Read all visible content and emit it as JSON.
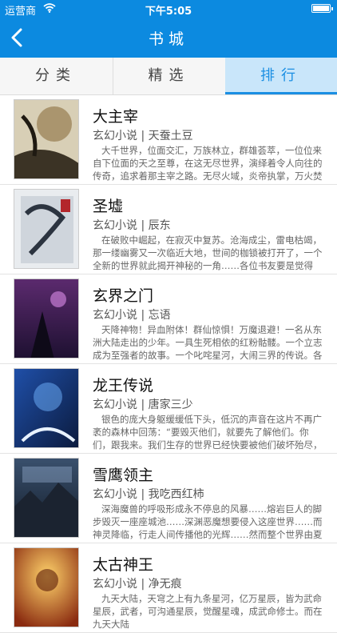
{
  "status_bar": {
    "carrier": "运营商",
    "time": "下午5:05"
  },
  "nav": {
    "title": "书城",
    "back_icon": "chevron-left-icon"
  },
  "tabs": [
    {
      "label": "分类",
      "selected": false
    },
    {
      "label": "精选",
      "selected": false
    },
    {
      "label": "排行",
      "selected": true
    }
  ],
  "colors": {
    "accent": "#0c8ae0",
    "tab_active_bg": "#c9e6fa",
    "tab_active_text": "#1b8fe3"
  },
  "books": [
    {
      "title": "大主宰",
      "genre": "玄幻小说",
      "author": "天蚕土豆",
      "desc": "大千世界，位面交汇，万族林立，群雄荟萃，一位位来自下位面的天之至尊，在这无尽世界，演绎着令人向往的传奇，追求着那主宰之路。无尽火域，炎帝执掌，万火焚苍",
      "cover_text": "大主宰"
    },
    {
      "title": "圣墟",
      "genre": "玄幻小说",
      "author": "辰东",
      "desc": "在破败中崛起，在寂灭中复苏。沧海成尘，雷电枯竭，那一缕幽雾又一次临近大地，世间的枷锁被打开了，一个全新的世界就此揭开神秘的一角……各位书友要是觉得《圣",
      "cover_text": "圣墟"
    },
    {
      "title": "玄界之门",
      "genre": "玄幻小说",
      "author": "忘语",
      "desc": "天降神物！异血附体！群仙惊惧！万魔退避！一名从东洲大陆走出的少年。一具生死相依的红粉骷髅。一个立志成为至强者的故事。一个叱咤星河，大闹三界的传说。各位",
      "cover_text": "玄界之门"
    },
    {
      "title": "龙王传说",
      "genre": "玄幻小说",
      "author": "唐家三少",
      "desc": "银色的庞大身躯缓缓低下头，低沉的声音在这片不再广袤的森林中回荡：“要毁灭他们，就要先了解他们。你们，跟我来。我们生存的世界已经快要被他们破坏殆尽，为了生",
      "cover_text": "龙王传说"
    },
    {
      "title": "雪鹰领主",
      "genre": "玄幻小说",
      "author": "我吃西红柿",
      "desc": "深海魔兽的呼吸形成永不停息的风暴……熔岩巨人的脚步毁灭一座座城池……深渊恶魔想要侵入这座世界……而神灵降临，行走人间传播他的光辉……然而整个世界由夏族帝",
      "cover_text": "雪鹰领主"
    },
    {
      "title": "太古神王",
      "genre": "玄幻小说",
      "author": "净无痕",
      "desc": "九天大陆，天穹之上有九条星河，亿万星辰，皆为武命星辰，武者，可沟通星辰，觉醒星魂，成武命修士。而在九天大陆",
      "cover_text": "太古神王"
    }
  ]
}
